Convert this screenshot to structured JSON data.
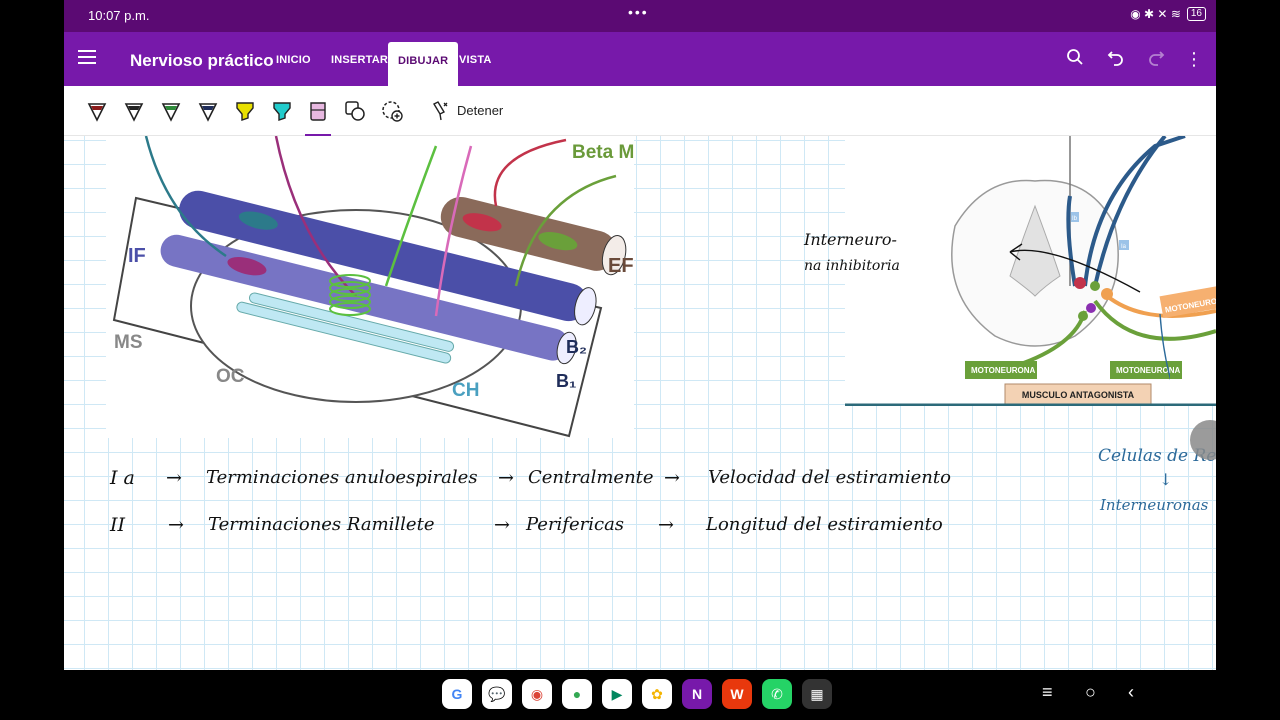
{
  "status": {
    "time": "10:07 p.m.",
    "battery": "16"
  },
  "app": {
    "title": "Nervioso práctico",
    "tabs": [
      {
        "label": "INICIO"
      },
      {
        "label": "INSERTAR"
      },
      {
        "label": "DIBUJAR",
        "active": true
      },
      {
        "label": "VISTA"
      }
    ]
  },
  "toolbar": {
    "pens": [
      {
        "name": "pen-dark-red",
        "color": "#8b1a1a"
      },
      {
        "name": "pen-black",
        "color": "#222222"
      },
      {
        "name": "pen-green",
        "color": "#2e8b3a"
      },
      {
        "name": "pen-navy",
        "color": "#1f2d5a"
      },
      {
        "name": "highlighter-yellow",
        "color": "#e8e000"
      },
      {
        "name": "highlighter-cyan",
        "color": "#22cccc"
      },
      {
        "name": "highlighter-pink",
        "color": "#e7b8e0"
      }
    ],
    "stop_label": "Detener"
  },
  "diagram1": {
    "labels": {
      "beta": "Beta MN",
      "if": "IF",
      "ef": "EF",
      "ms": "MS",
      "oc": "OC",
      "ch": "CH",
      "b2": "B₂",
      "b1": "B₁"
    }
  },
  "diagram2": {
    "labels": {
      "motoneurona1": "MOTONEURONA α",
      "motoneurona2": "MOTONEURONA α",
      "motoneurona3": "MOTONEURONA",
      "musculo": "MUSCULO ANTAGONISTA",
      "ib": "Ib",
      "ia": "Ia"
    }
  },
  "notes": {
    "interneurona1": "Interneuro-",
    "interneurona2": "na inhibitoria",
    "renshaw": "Celulas de Ren",
    "arrow": "↓",
    "interneuronas": "Interneuronas",
    "row1": {
      "c1": "I a",
      "c2": "Terminaciones anuloespirales",
      "c3": "Centralmente",
      "c4": "Velocidad del estiramiento"
    },
    "row2": {
      "c1": "II",
      "c2": "Terminaciones Ramillete",
      "c3": "Perifericas",
      "c4": "Longitud del estiramiento"
    },
    "arrowSymbol": "→"
  },
  "dock": {
    "apps": [
      {
        "name": "google-app",
        "glyph": "G",
        "color": "#4285f4"
      },
      {
        "name": "messages-app",
        "glyph": "💬",
        "color": "#1a73e8"
      },
      {
        "name": "chrome-app",
        "glyph": "◉",
        "color": "#db4437"
      },
      {
        "name": "assistant-app",
        "glyph": "●",
        "color": "#34a853"
      },
      {
        "name": "play-store-app",
        "glyph": "▶",
        "color": "#01875f"
      },
      {
        "name": "photos-app",
        "glyph": "✿",
        "color": "#f4b400"
      },
      {
        "name": "onenote-app",
        "glyph": "N",
        "color": "#7719aa"
      },
      {
        "name": "wps-app",
        "glyph": "W",
        "color": "#e8380d"
      },
      {
        "name": "whatsapp-app",
        "glyph": "✆",
        "color": "#25d366"
      },
      {
        "name": "all-apps",
        "glyph": "▦",
        "color": "#333333"
      }
    ]
  }
}
